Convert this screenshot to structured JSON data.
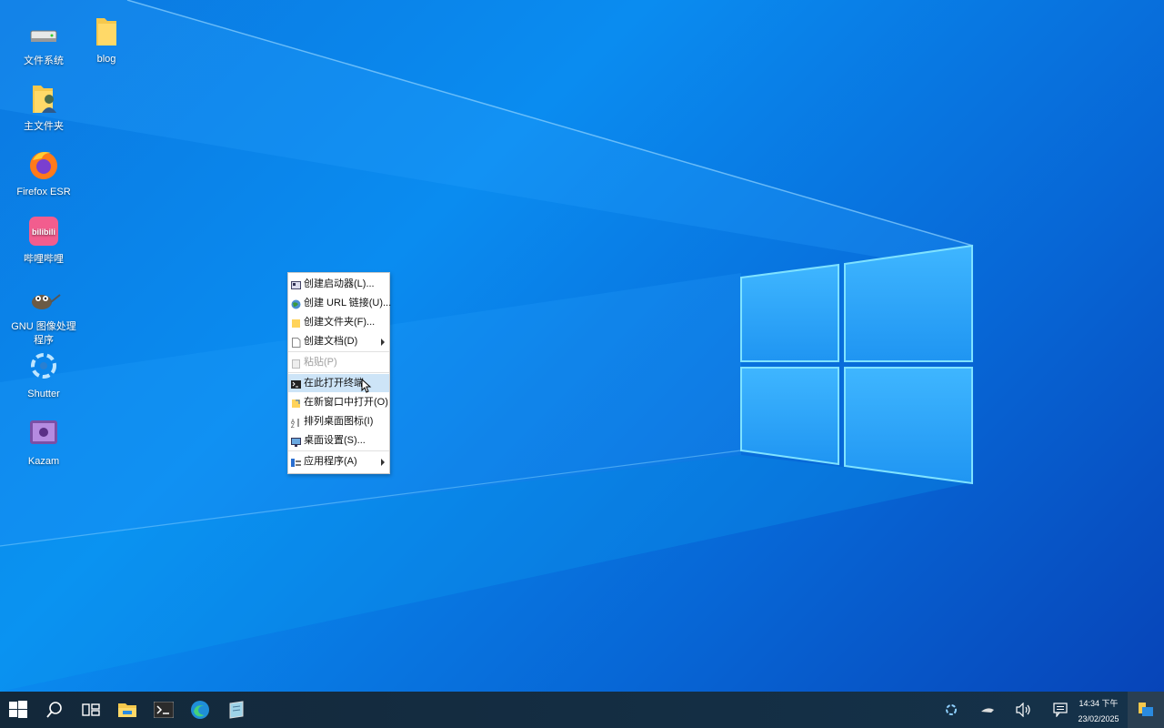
{
  "desktop": {
    "icons": [
      {
        "label": "文件系统",
        "icon": "drive-icon"
      },
      {
        "label": "blog",
        "icon": "folder-icon"
      },
      {
        "label": "主文件夹",
        "icon": "home-folder-icon"
      },
      {
        "label": "Firefox ESR",
        "icon": "firefox-icon"
      },
      {
        "label": "哔哩哔哩",
        "icon": "bilibili-icon",
        "logo_text": "bilibili"
      },
      {
        "label": "GNU 图像处理程序",
        "icon": "gimp-icon"
      },
      {
        "label": "Shutter",
        "icon": "shutter-icon"
      },
      {
        "label": "Kazam",
        "icon": "kazam-icon"
      }
    ]
  },
  "context_menu": {
    "items": [
      {
        "label": "创建启动器(L)...",
        "icon": "launcher-icon"
      },
      {
        "label": "创建 URL 链接(U)...",
        "icon": "globe-icon"
      },
      {
        "label": "创建文件夹(F)...",
        "icon": "folder-icon"
      },
      {
        "label": "创建文档(D)",
        "icon": "document-icon",
        "submenu": true
      },
      {
        "label": "粘贴(P)",
        "icon": "paste-icon",
        "disabled": true
      },
      {
        "label": "在此打开终端",
        "icon": "terminal-icon",
        "highlighted": true
      },
      {
        "label": "在新窗口中打开(O)",
        "icon": "open-window-icon"
      },
      {
        "label": "排列桌面图标(I)",
        "icon": "sort-icon"
      },
      {
        "label": "桌面设置(S)...",
        "icon": "desktop-settings-icon"
      },
      {
        "label": "应用程序(A)",
        "icon": "applications-icon",
        "submenu": true
      }
    ]
  },
  "taskbar": {
    "buttons": [
      "start-icon",
      "search-icon",
      "task-view-icon",
      "file-explorer-icon",
      "terminal-icon",
      "edge-icon",
      "notes-app-icon"
    ],
    "tray": [
      "shutter-tray-icon",
      "network-icon",
      "volume-icon",
      "notification-icon"
    ],
    "clock": {
      "time": "14:34 下午",
      "date": "23/02/2025"
    }
  },
  "colors": {
    "menu_highlight": "#cde4f7",
    "taskbar": "#13283a",
    "desktop_blue": "#0a8cf0"
  }
}
